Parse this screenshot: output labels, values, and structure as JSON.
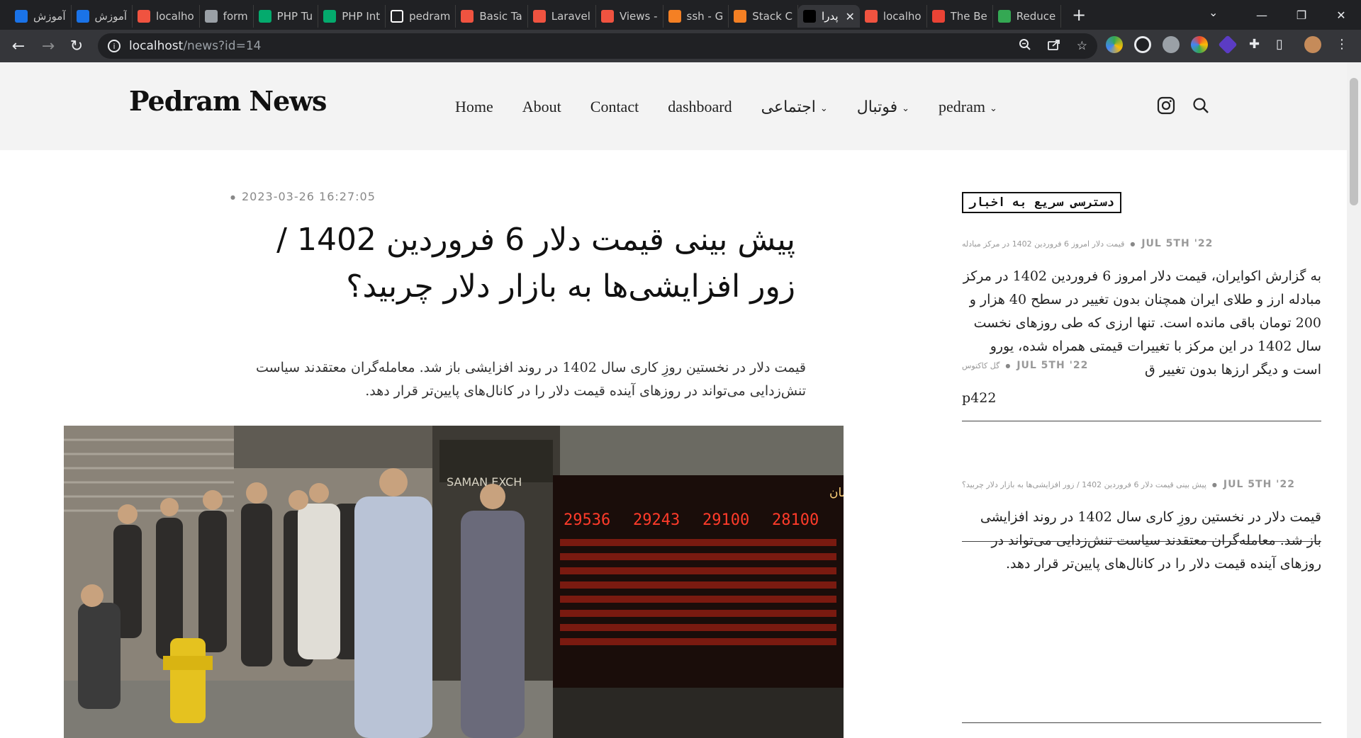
{
  "browser": {
    "tabs": [
      {
        "label": "آموزش",
        "favicon": "tutorial-icon",
        "color": "#1a73e8"
      },
      {
        "label": "آموزش",
        "favicon": "tutorial-icon",
        "color": "#1a73e8"
      },
      {
        "label": "localho",
        "favicon": "laravel-icon",
        "color": "#f05340"
      },
      {
        "label": "form",
        "favicon": "globe-icon",
        "color": "#9aa0a6"
      },
      {
        "label": "PHP Tu",
        "favicon": "w3schools-icon",
        "color": "#04aa6d"
      },
      {
        "label": "PHP Int",
        "favicon": "w3schools-icon",
        "color": "#04aa6d"
      },
      {
        "label": "pedram",
        "favicon": "github-icon",
        "color": "#ffffff"
      },
      {
        "label": "Basic Ta",
        "favicon": "laravel-icon",
        "color": "#f05340"
      },
      {
        "label": "Laravel",
        "favicon": "laravel-icon",
        "color": "#f05340"
      },
      {
        "label": "Views -",
        "favicon": "laravel-icon",
        "color": "#f05340"
      },
      {
        "label": "ssh - G",
        "favicon": "stackoverflow-icon",
        "color": "#f48024"
      },
      {
        "label": "Stack C",
        "favicon": "stackoverflow-icon",
        "color": "#f48024"
      },
      {
        "label": "پدرا",
        "favicon": "page-icon",
        "color": "#000000",
        "active": true
      },
      {
        "label": "localho",
        "favicon": "laravel-icon",
        "color": "#f05340"
      },
      {
        "label": "The Be",
        "favicon": "chrome-red-icon",
        "color": "#ea4335"
      },
      {
        "label": "Reduce",
        "favicon": "reduce-icon",
        "color": "#34a853"
      }
    ],
    "url_host": "localhost",
    "url_path": "/news?id=14"
  },
  "site": {
    "logo": "Pedram News",
    "nav": [
      {
        "label": "Home",
        "dropdown": false
      },
      {
        "label": "About",
        "dropdown": false
      },
      {
        "label": "Contact",
        "dropdown": false
      },
      {
        "label": "dashboard",
        "dropdown": false
      },
      {
        "label": "اجتماعی",
        "dropdown": true
      },
      {
        "label": "فوتبال",
        "dropdown": true
      },
      {
        "label": "pedram",
        "dropdown": true
      }
    ]
  },
  "article": {
    "date": "2023-03-26 16:27:05",
    "title": "پیش بینی قیمت دلار 6 فروردین 1402 / زور افزایشی‌ها به بازار دلار چربید؟",
    "lead": "قیمت دلار در نخستین روزِ کاری سال 1402 در روند افزایشی باز شد. معامله‌گران معتقدند سیاست تنش‌زدایی می‌تواند در روزهای آینده قیمت دلار را در کانال‌های پایین‌تر قرار دهد."
  },
  "sidebar": {
    "title": "دسترسی سریع به اخبار",
    "posts": [
      {
        "category": "قیمت دلار امروز 6 فروردین 1402 در مرکز مبادله",
        "date": "JUL 5TH '22",
        "body": "به گزارش اکوایران، قیمت دلار امروز 6 فروردین 1402 در مرکز مبادله ارز و طلای ایران همچنان بدون تغییر در سطح 40 هزار و 200 تومان باقی مانده است. تنها ارزی که طی روزهای نخست سال 1402 در این مرکز با تغییرات قیمتی همراه شده، یورو است و دیگر ارزها بدون تغییر ق"
      },
      {
        "category": "گل کاکتوس",
        "date": "JUL 5TH '22",
        "body": "p422"
      },
      {
        "category": "پیش بینی قیمت دلار 6 فروردین 1402 / زور افزایشی‌ها به بازار دلار چربید؟",
        "date": "JUL 5TH '22",
        "body": "قیمت دلار در نخستین روزِ کاری سال 1402 در روند افزایشی باز شد. معامله‌گران معتقدند سیاست تنش‌زدایی می‌تواند در روزهای آینده قیمت دلار را در کانال‌های پایین‌تر قرار دهد."
      }
    ]
  },
  "image": {
    "shop_sign": "SAMAN EXCH",
    "board_title": "صرافی آرمین سامان",
    "board_rates": [
      "29536",
      "29243",
      "29100",
      "28100"
    ]
  }
}
